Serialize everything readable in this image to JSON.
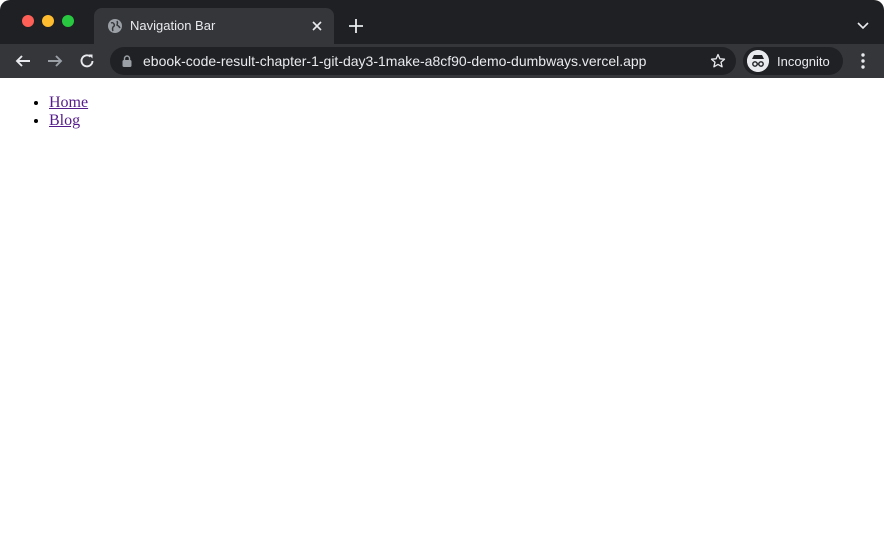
{
  "browser": {
    "tab": {
      "title": "Navigation Bar",
      "favicon": "globe-icon"
    },
    "address_bar": {
      "url": "ebook-code-result-chapter-1-git-day3-1make-a8cf90-demo-dumbways.vercel.app"
    },
    "profile": {
      "label": "Incognito"
    },
    "colors": {
      "chrome_dark": "#1f2023",
      "toolbar": "#35363a",
      "omnibox": "#202124"
    }
  },
  "page": {
    "nav": {
      "items": [
        {
          "label": "Home"
        },
        {
          "label": "Blog"
        }
      ],
      "link_color": "#551a8b"
    }
  }
}
